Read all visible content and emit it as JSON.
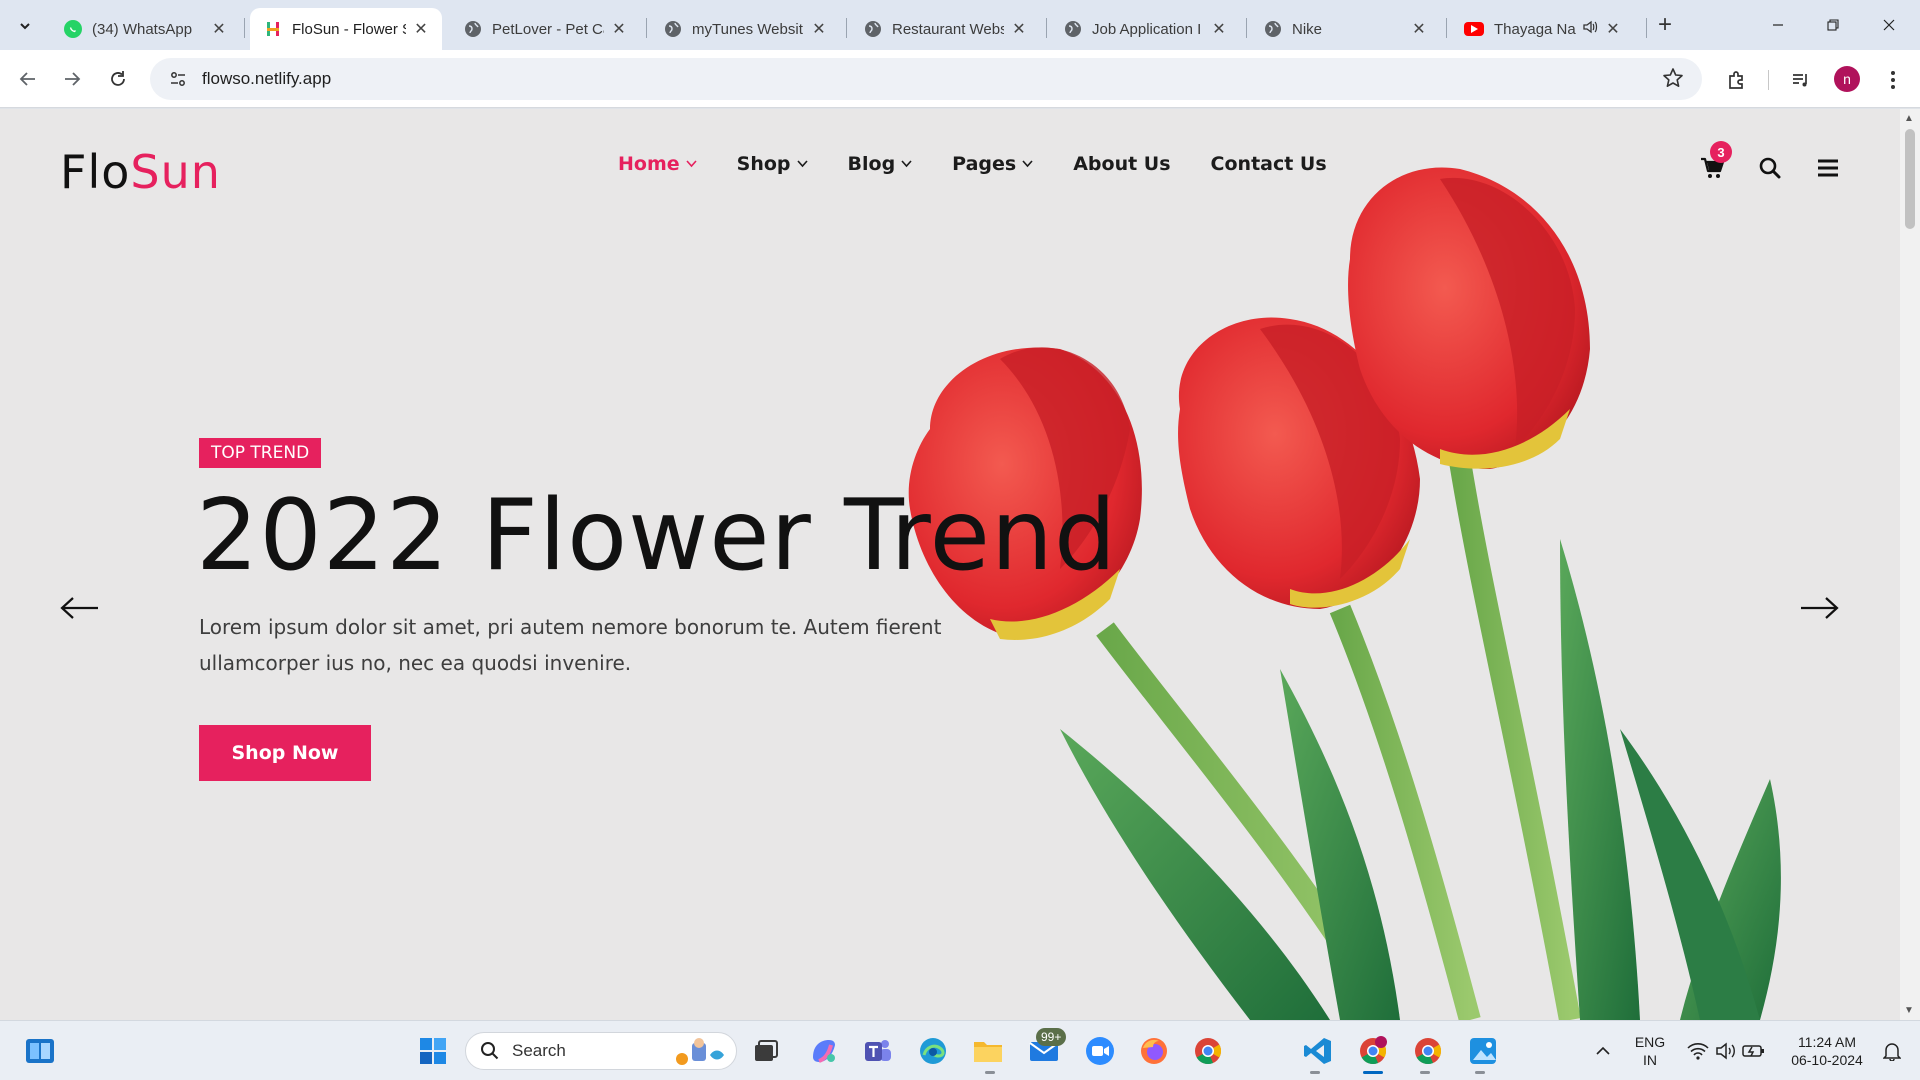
{
  "browser": {
    "tabs": [
      {
        "title": "(34) WhatsApp",
        "favicon": "whatsapp-icon",
        "color": "#25d366"
      },
      {
        "title": "FloSun - Flower S",
        "favicon": "flosun-icon",
        "color": "#e6215e",
        "active": true
      },
      {
        "title": "PetLover - Pet Ca",
        "favicon": "globe-icon",
        "color": "#5f6368"
      },
      {
        "title": "myTunes Websit",
        "favicon": "globe-icon",
        "color": "#5f6368"
      },
      {
        "title": "Restaurant Webs",
        "favicon": "globe-icon",
        "color": "#5f6368"
      },
      {
        "title": "Job Application I",
        "favicon": "globe-icon",
        "color": "#5f6368"
      },
      {
        "title": "Nike",
        "favicon": "globe-icon",
        "color": "#5f6368"
      },
      {
        "title": "Thayaga Naa",
        "favicon": "youtube-icon",
        "color": "#ff0000",
        "audio": true
      }
    ],
    "url": "flowso.netlify.app",
    "profile_initial": "n"
  },
  "site": {
    "logo": {
      "part1": "Flo",
      "part2": "Sun"
    },
    "menu": [
      {
        "label": "Home",
        "dropdown": true,
        "active": true
      },
      {
        "label": "Shop",
        "dropdown": true
      },
      {
        "label": "Blog",
        "dropdown": true
      },
      {
        "label": "Pages",
        "dropdown": true
      },
      {
        "label": "About Us",
        "dropdown": false
      },
      {
        "label": "Contact Us",
        "dropdown": false
      }
    ],
    "cart_count": "3",
    "accent": "#e6215e"
  },
  "hero": {
    "badge": "TOP TREND",
    "headline": "2022 Flower Trend",
    "body": "Lorem ipsum dolor sit amet, pri autem nemore bonorum te. Autem fierent ullamcorper ius no, nec ea quodsi invenire.",
    "cta": "Shop Now"
  },
  "taskbar": {
    "search_placeholder": "Search",
    "mail_badge": "99+",
    "language": {
      "line1": "ENG",
      "line2": "IN"
    },
    "time": "11:24 AM",
    "date": "06-10-2024"
  }
}
